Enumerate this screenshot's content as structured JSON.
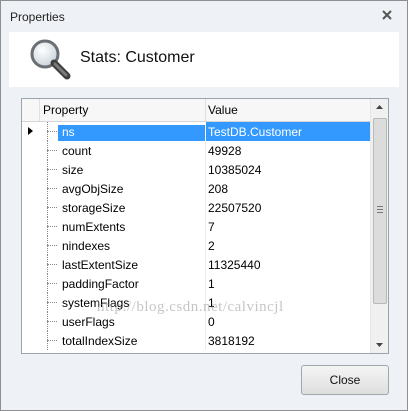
{
  "window": {
    "title": "Properties",
    "close_icon": "close-x-icon"
  },
  "header": {
    "title": "Stats: Customer",
    "icon": "magnifier-icon"
  },
  "grid": {
    "columns": [
      "Property",
      "Value"
    ],
    "rows": [
      {
        "name": "ns",
        "value": "TestDB.Customer",
        "selected": true
      },
      {
        "name": "count",
        "value": "49928"
      },
      {
        "name": "size",
        "value": "10385024"
      },
      {
        "name": "avgObjSize",
        "value": "208"
      },
      {
        "name": "storageSize",
        "value": "22507520"
      },
      {
        "name": "numExtents",
        "value": "7"
      },
      {
        "name": "nindexes",
        "value": "2"
      },
      {
        "name": "lastExtentSize",
        "value": "11325440"
      },
      {
        "name": "paddingFactor",
        "value": "1"
      },
      {
        "name": "systemFlags",
        "value": "1"
      },
      {
        "name": "userFlags",
        "value": "0"
      },
      {
        "name": "totalIndexSize",
        "value": "3818192"
      }
    ],
    "selection_color": "#3399ff"
  },
  "watermark": "http://blog.csdn.net/calvincjl",
  "footer": {
    "close_label": "Close"
  }
}
